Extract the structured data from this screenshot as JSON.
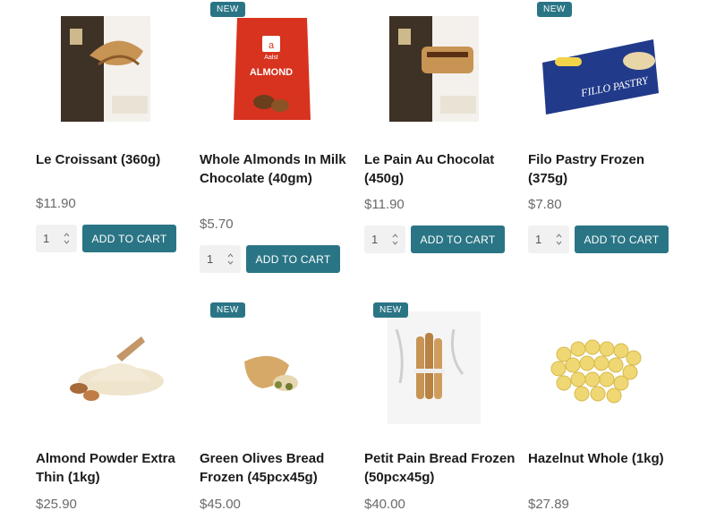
{
  "products": [
    {
      "title": "Le Croissant (360g)",
      "price": "$11.90",
      "badge": "",
      "qty": "1",
      "cart_label": "ADD TO CART"
    },
    {
      "title": "Whole Almonds In Milk Chocolate (40gm)",
      "price": "$5.70",
      "badge": "NEW",
      "qty": "1",
      "cart_label": "ADD TO CART",
      "pack_brand": "Aalst",
      "pack_label": "ALMOND"
    },
    {
      "title": "Le Pain Au Chocolat (450g)",
      "price": "$11.90",
      "badge": "",
      "qty": "1",
      "cart_label": "ADD TO CART"
    },
    {
      "title": "Filo Pastry Frozen (375g)",
      "price": "$7.80",
      "badge": "NEW",
      "qty": "1",
      "cart_label": "ADD TO CART",
      "pack_label": "FILLO PASTRY"
    },
    {
      "title": "Almond Powder Extra Thin (1kg)",
      "price": "$25.90",
      "badge": ""
    },
    {
      "title": "Green Olives Bread Frozen (45pcx45g)",
      "price": "$45.00",
      "badge": "NEW"
    },
    {
      "title": "Petit Pain Bread Frozen (50pcx45g)",
      "price": "$40.00",
      "badge": "NEW"
    },
    {
      "title": "Hazelnut Whole (1kg)",
      "price": "$27.89",
      "badge": ""
    }
  ],
  "colors": {
    "accent": "#2a7585",
    "qty_bg": "#f1f1f1",
    "price": "#6a6a6a"
  }
}
